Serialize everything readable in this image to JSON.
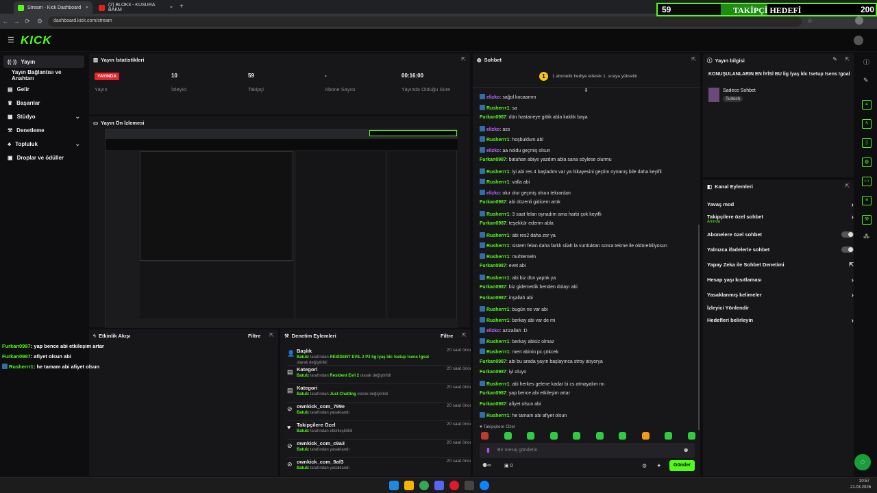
{
  "browser": {
    "tabs": [
      {
        "title": "Stream - Kick Dashboard",
        "close": "×"
      },
      {
        "title": "(2) BLOK3 - KUSURA BAKM",
        "close": "×"
      }
    ],
    "new_tab": "+",
    "url": "dashboard.kick.com/stream"
  },
  "overlay": {
    "current": "59",
    "label": "TAKİPÇİ HEDEFİ",
    "target": "200",
    "progress": 0.295
  },
  "header": {
    "logo": "KICK"
  },
  "sidebar": {
    "items": [
      {
        "label": "Yayın",
        "icon": "broadcast-icon"
      },
      {
        "label": "Yayın Bağlantısı ve Anahtarı",
        "icon": ""
      },
      {
        "label": "Gelir",
        "icon": "money-icon"
      },
      {
        "label": "Başarılar",
        "icon": "trophy-icon"
      },
      {
        "label": "Stüdyo",
        "icon": "studio-icon"
      },
      {
        "label": "Denetleme",
        "icon": "wrench-icon"
      },
      {
        "label": "Topluluk",
        "icon": "community-icon"
      },
      {
        "label": "Droplar ve ödüller",
        "icon": "gift-icon"
      }
    ]
  },
  "stats": {
    "title": "Yayın İstatistikleri",
    "live_badge": "YAYINDA",
    "items": [
      {
        "value": "",
        "label": "Yayın"
      },
      {
        "value": "10",
        "label": "İzleyici"
      },
      {
        "value": "59",
        "label": "Takipçi"
      },
      {
        "value": "-",
        "label": "Abone Sayısı"
      },
      {
        "value": "00:16:00",
        "label": "Yayında Olduğu Süre"
      }
    ]
  },
  "preview": {
    "title": "Yayın Ön İzlemesi"
  },
  "activity": {
    "title": "Etkinlik Akışı",
    "filter": "Filtre",
    "messages": [
      {
        "user": "Furkan0987",
        "text": ": yap bence abi etkileşim artar",
        "badge": false
      },
      {
        "user": "Furkan0987",
        "text": ": afiyet olsun abi",
        "badge": false
      },
      {
        "user": "Rusherrr1",
        "text": ": he tamam abi afiyet olsun",
        "badge": true
      }
    ]
  },
  "moderation": {
    "title": "Denetim Eylemleri",
    "filter": "Filtre",
    "items": [
      {
        "title": "Başlık",
        "actor": "Batulz",
        "mid": " tarafından ",
        "obj": "RESİDENT EVIL 2 P2 lig lyaş ldc !setup !sens !goal",
        "end": " olarak değiştirildi",
        "time": "20 saat önce"
      },
      {
        "title": "Kategori",
        "actor": "Batulz",
        "mid": " tarafından ",
        "obj": "Resident Evil 2",
        "end": " olarak değiştirildi",
        "time": "20 saat önce"
      },
      {
        "title": "Kategori",
        "actor": "Batulz",
        "mid": " tarafından ",
        "obj": "Just Chatting",
        "end": " olarak değiştirildi",
        "time": "20 saat önce"
      },
      {
        "title": "ownkick_com_799e",
        "actor": "Batulz",
        "mid": " tarafından yasaklandı",
        "obj": "",
        "end": "",
        "time": "20 saat önce"
      },
      {
        "title": "Takipçilere Özel",
        "actor": "Batulz",
        "mid": " tarafından etkinleştirildi",
        "obj": "",
        "end": "",
        "time": "20 saat önce"
      },
      {
        "title": "ownkick_com_c9a3",
        "actor": "Batulz",
        "mid": " tarafından yasaklandı",
        "obj": "",
        "end": "",
        "time": "20 saat önce"
      },
      {
        "title": "ownkick_com_9af3",
        "actor": "Batulz",
        "mid": " tarafından yasaklandı",
        "obj": "",
        "end": "",
        "time": "20 saat önce"
      }
    ]
  },
  "chat": {
    "title": "Sohbet",
    "gift_banner": "1 abonelik hediye ederek 1. sıraya yükselin",
    "messages": [
      {
        "user": "elizko",
        "text": ": sağol kocaamm",
        "color": "#b86bff",
        "badge": true
      },
      {
        "user": "Rusherrr1",
        "text": ": sa",
        "color": "#53fc18",
        "badge": true
      },
      {
        "user": "Furkan0987",
        "text": ": dün hastaneye gittik abla kaldık baya",
        "color": "#53fc18",
        "badge": false
      },
      {
        "user": "elizko",
        "text": ": ass",
        "color": "#b86bff",
        "badge": true
      },
      {
        "user": "Rusherrr1",
        "text": ": hoşbuldum abl",
        "color": "#53fc18",
        "badge": true
      },
      {
        "user": "elizko",
        "text": ": aa noldu geçmiş olsun",
        "color": "#b86bff",
        "badge": true
      },
      {
        "user": "Furkan0987",
        "text": ": batuhan abiye yazdım abla sana söylese olurmu",
        "color": "#53fc18",
        "badge": false
      },
      {
        "user": "Rusherrr1",
        "text": ": iyi abi res 4 başladım var ya hikayesini geçtim oynanış bile daha keyifli",
        "color": "#53fc18",
        "badge": true
      },
      {
        "user": "Rusherrr1",
        "text": ": valla abi",
        "color": "#53fc18",
        "badge": true
      },
      {
        "user": "elizko",
        "text": ": olur olur geçmiş olsun tekrardan",
        "color": "#b86bff",
        "badge": true
      },
      {
        "user": "Furkan0987",
        "text": ": abi düzenli gidicem artık",
        "color": "#53fc18",
        "badge": false
      },
      {
        "user": "Rusherrr1",
        "text": ": 3 saat felan oynadım ama harbi çok keyifli",
        "color": "#53fc18",
        "badge": true
      },
      {
        "user": "Furkan0987",
        "text": ": teşekkür ederim abla",
        "color": "#53fc18",
        "badge": false
      },
      {
        "user": "Rusherrr1",
        "text": ": abi res2 daha zor ya",
        "color": "#53fc18",
        "badge": true
      },
      {
        "user": "Rusherrr1",
        "text": ": sistem felan daha farklı silah la vurduktan sonra tekme ile öldürebiliyosun",
        "color": "#53fc18",
        "badge": true
      },
      {
        "user": "Rusherrr1",
        "text": ": muhtemeln",
        "color": "#53fc18",
        "badge": true
      },
      {
        "user": "Furkan0987",
        "text": ": evet abi",
        "color": "#53fc18",
        "badge": false
      },
      {
        "user": "Rusherrr1",
        "text": ": abi biz dün yaptık ya",
        "color": "#53fc18",
        "badge": true
      },
      {
        "user": "Furkan0987",
        "text": ": biz gidemedik benden dolayı abi",
        "color": "#53fc18",
        "badge": false
      },
      {
        "user": "Furkan0987",
        "text": ": inşallah abi",
        "color": "#53fc18",
        "badge": false
      },
      {
        "user": "Rusherrr1",
        "text": ": bugün ne var abi",
        "color": "#53fc18",
        "badge": true
      },
      {
        "user": "Rusherrr1",
        "text": ": berkay abi var de mi",
        "color": "#53fc18",
        "badge": true
      },
      {
        "user": "elizko",
        "text": ": azizallah :D",
        "color": "#b86bff",
        "badge": true
      },
      {
        "user": "Rusherrr1",
        "text": ": berkay abisiz olmaz",
        "color": "#53fc18",
        "badge": true
      },
      {
        "user": "Rusherrr1",
        "text": ": mert abinin pc çökcek",
        "color": "#53fc18",
        "badge": true
      },
      {
        "user": "Furkan0987",
        "text": ": abi bu arada yayın başlayınca stroy atıyorya",
        "color": "#53fc18",
        "badge": false
      },
      {
        "user": "Furkan0987",
        "text": ": iyi oluyo",
        "color": "#53fc18",
        "badge": false
      },
      {
        "user": "Rusherrr1",
        "text": ": abi herkes gelene kadar bi cs atmayalım mı",
        "color": "#53fc18",
        "badge": true
      },
      {
        "user": "Furkan0987",
        "text": ": yap bence abi etkileşim artar",
        "color": "#53fc18",
        "badge": false
      },
      {
        "user": "Furkan0987",
        "text": ": afiyet olsun abi",
        "color": "#53fc18",
        "badge": false
      },
      {
        "user": "Rusherrr1",
        "text": ": he tamam abi afiyet olsun",
        "color": "#53fc18",
        "badge": true
      }
    ],
    "followers_only": "Takipçilere Özel",
    "input_placeholder": "Bir mesaj gönderin",
    "infinity": "∞",
    "count": "0",
    "send": "Gönder"
  },
  "stream_info": {
    "title": "Yayın bilgisi",
    "stream_title": "KONUŞULANLARIN EN İYİSİ BU lig lyaş ldc !setup !sens !goal",
    "category": "Sadece Sohbet",
    "language": "Turkish"
  },
  "channel_actions": {
    "title": "Kanal Eylemleri",
    "items": [
      {
        "label": "Yavaş mod",
        "sub": "",
        "control": "arrow"
      },
      {
        "label": "Takipçilere özel sohbet",
        "sub": "Anında",
        "control": "arrow"
      },
      {
        "label": "Abonelere özel sohbet",
        "sub": "",
        "control": "toggle"
      },
      {
        "label": "Yalnızca ifadelerle sohbet",
        "sub": "",
        "control": "toggle"
      },
      {
        "label": "Yapay Zeka ile Sohbet Denetimi",
        "sub": "",
        "control": "external"
      },
      {
        "label": "Hesap yaşı kısıtlaması",
        "sub": "",
        "control": "arrow"
      },
      {
        "label": "Yasaklanmış kelimeler",
        "sub": "",
        "control": "arrow"
      },
      {
        "label": "İzleyici Yönlendir",
        "sub": "",
        "control": ""
      },
      {
        "label": "Hedefleri belirleyin",
        "sub": "",
        "control": "arrow"
      }
    ]
  },
  "taskbar": {
    "time": "20:57",
    "date": "21.03.2026"
  },
  "colors": {
    "accent": "#53fc18",
    "live": "#e8232a",
    "panel": "#17171a"
  }
}
